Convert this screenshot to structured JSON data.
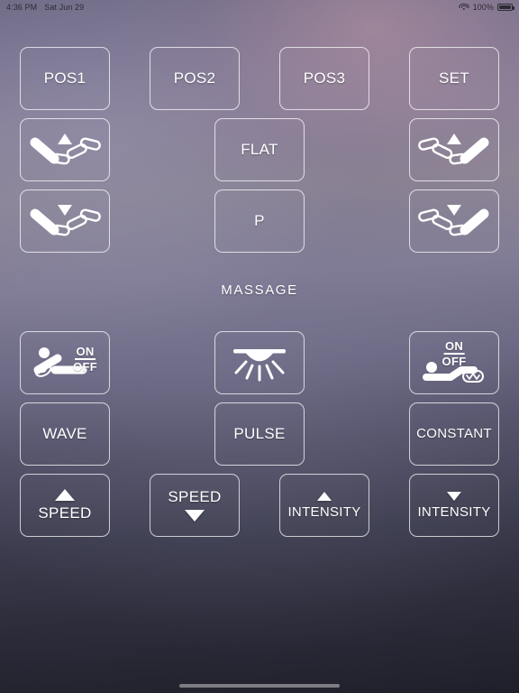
{
  "status_bar": {
    "time": "4:36 PM",
    "date": "Sat Jun 29",
    "battery_percent": "100%",
    "wifi_icon": "wifi-icon",
    "battery_icon": "battery-full-icon"
  },
  "sections": {
    "massage_label": "MASSAGE"
  },
  "buttons": {
    "pos1": "POS1",
    "pos2": "POS2",
    "pos3": "POS3",
    "set": "SET",
    "flat": "FLAT",
    "p": "P",
    "head_up": "head-up-icon",
    "head_down": "head-down-icon",
    "foot_up": "foot-up-icon",
    "foot_down": "foot-down-icon",
    "head_massage_on": "ON",
    "head_massage_off": "OFF",
    "foot_massage_on": "ON",
    "foot_massage_off": "OFF",
    "light": "underbed-light-icon",
    "wave": "WAVE",
    "pulse": "PULSE",
    "constant": "CONSTANT",
    "speed_up": "SPEED",
    "speed_down": "SPEED",
    "intensity_up": "INTENSITY",
    "intensity_down": "INTENSITY"
  },
  "colors": {
    "button_border": "#ffffff",
    "text": "#ffffff",
    "background_top": "#8a8098",
    "background_bottom": "#1f1f2a"
  }
}
